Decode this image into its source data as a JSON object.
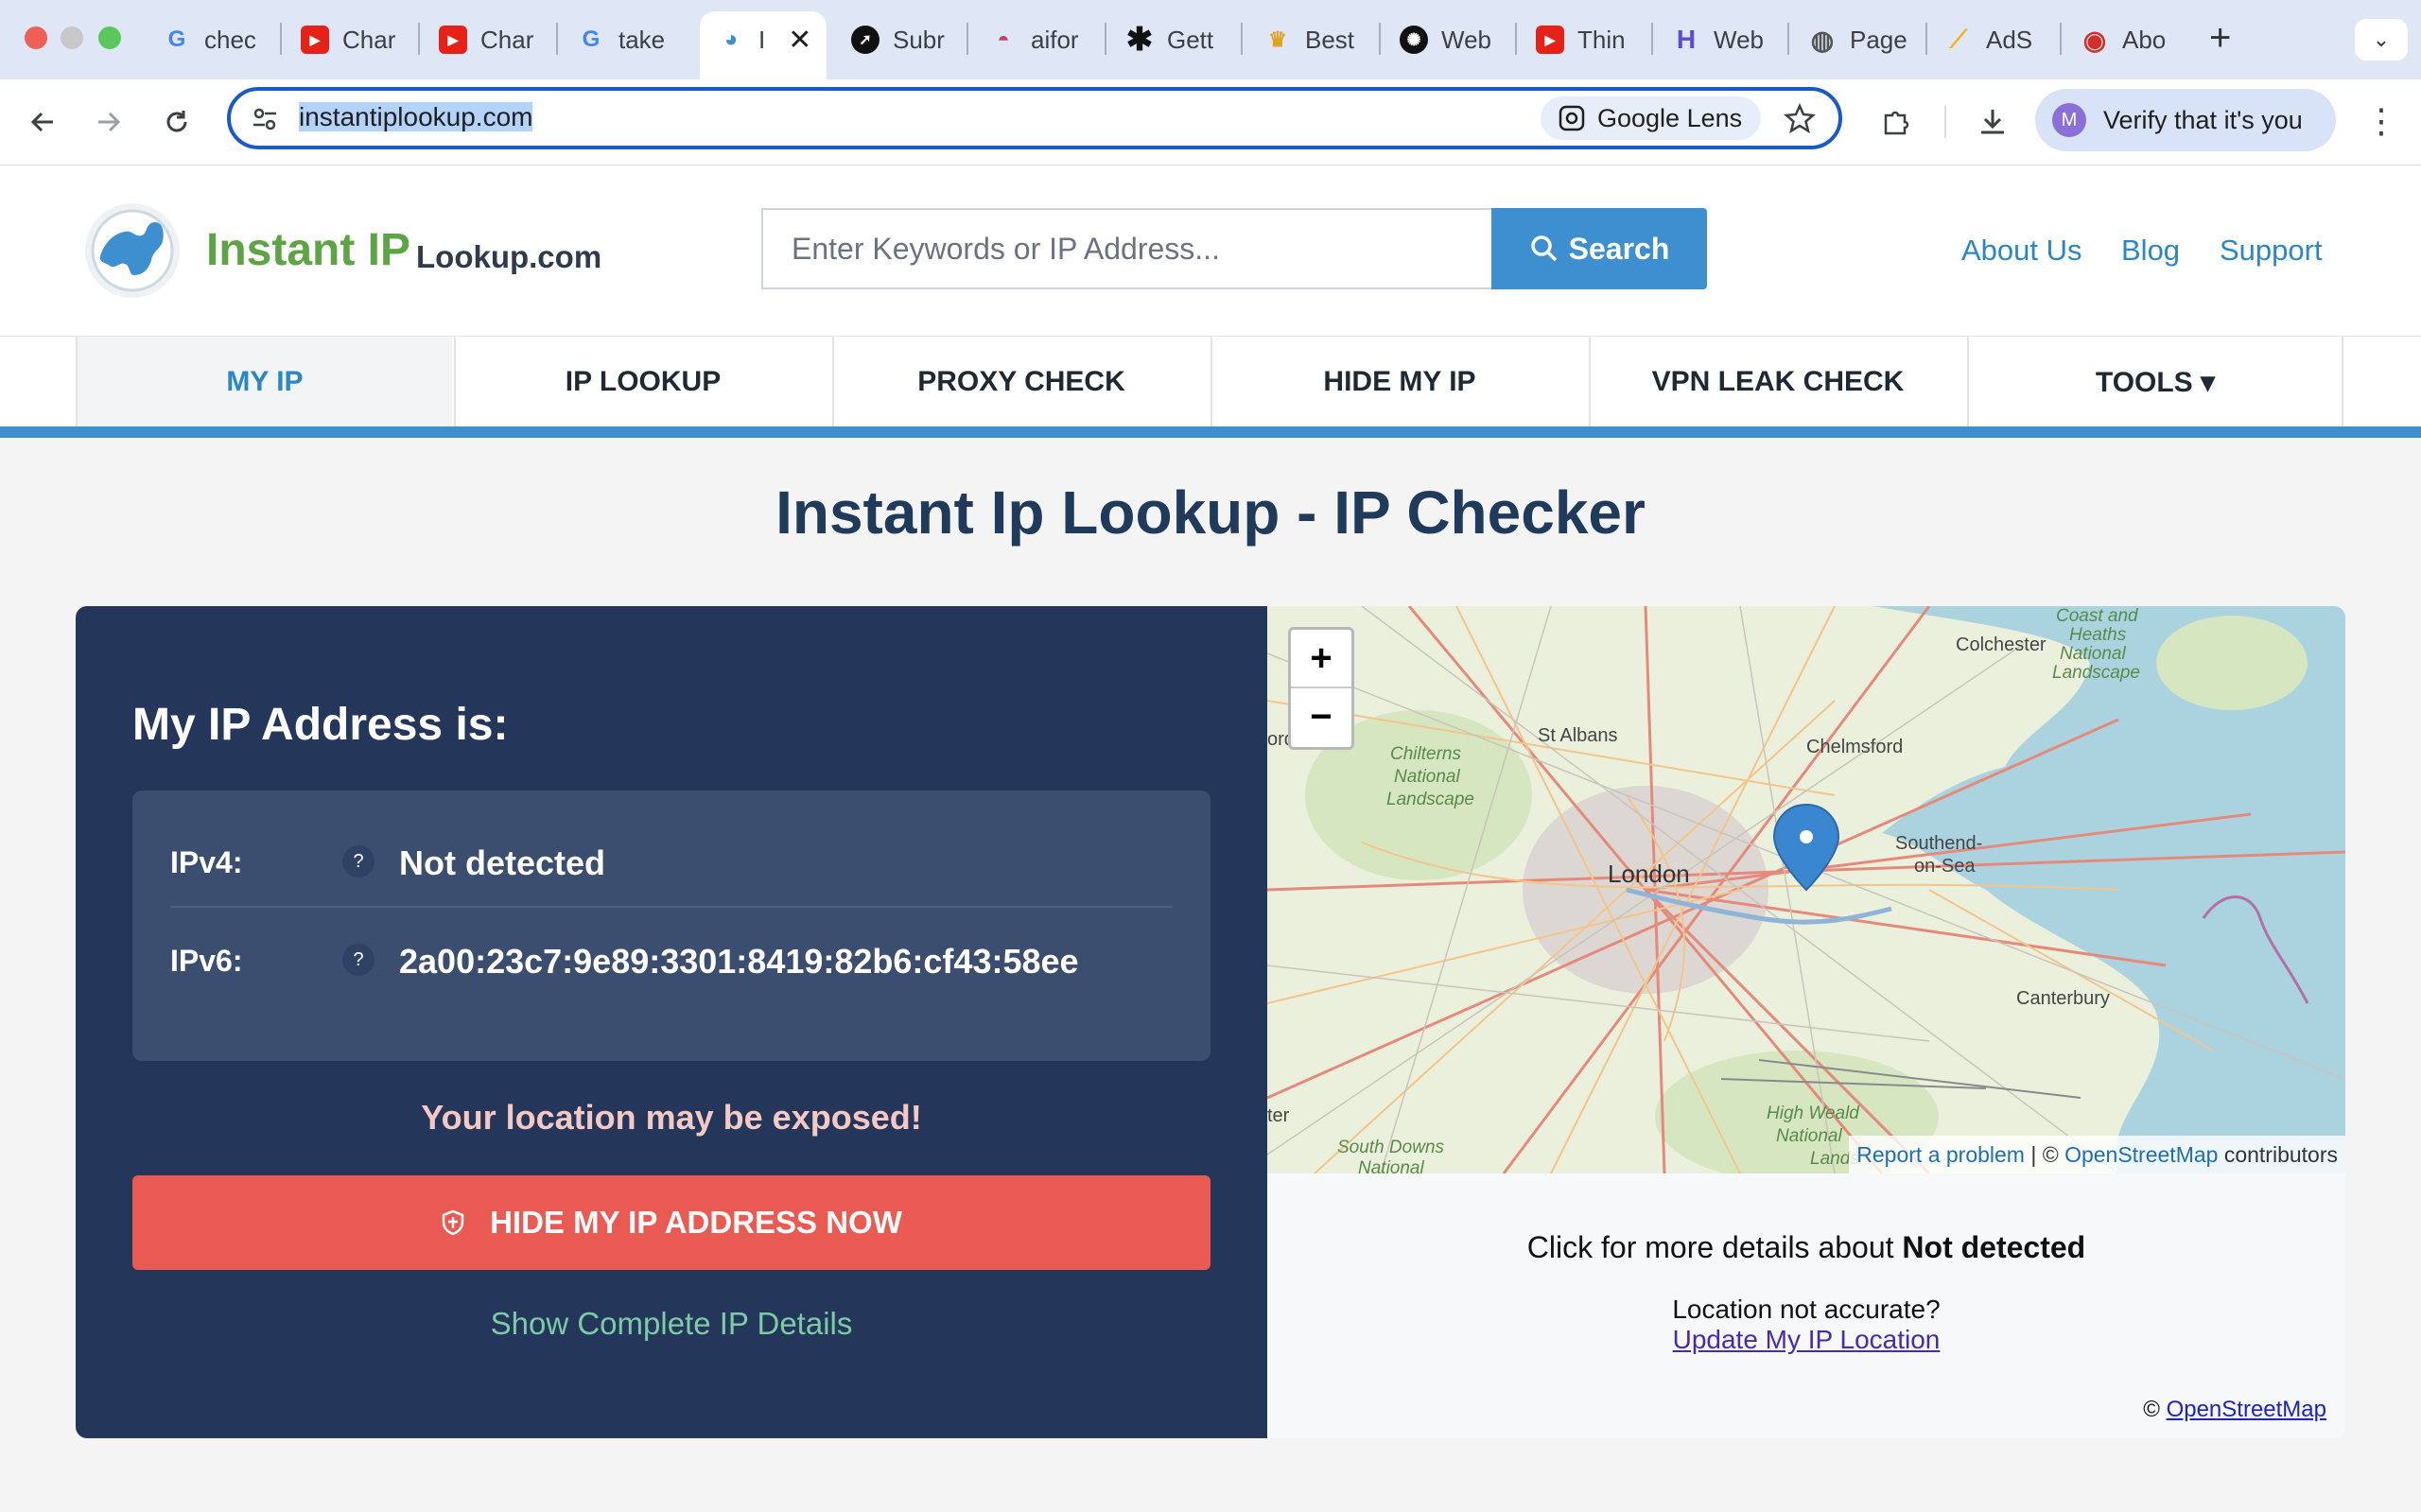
{
  "browser": {
    "tabs": [
      {
        "title": "chec",
        "icon": "google-icon"
      },
      {
        "title": "Char",
        "icon": "youtube-icon"
      },
      {
        "title": "Char",
        "icon": "youtube-icon"
      },
      {
        "title": "take",
        "icon": "google-icon"
      },
      {
        "title": "I",
        "icon": "instantip-icon",
        "active": true
      },
      {
        "title": "Subr",
        "icon": "rocket-icon"
      },
      {
        "title": "aifor",
        "icon": "mascot-icon"
      },
      {
        "title": "Gett",
        "icon": "asterisk-icon"
      },
      {
        "title": "Best",
        "icon": "crown-icon"
      },
      {
        "title": "Web",
        "icon": "openai-icon"
      },
      {
        "title": "Thin",
        "icon": "youtube-icon"
      },
      {
        "title": "Web",
        "icon": "h-logo-icon"
      },
      {
        "title": "Page",
        "icon": "globe-icon"
      },
      {
        "title": "AdS",
        "icon": "adsense-icon"
      },
      {
        "title": "Abo",
        "icon": "target-icon"
      }
    ],
    "url": "instantiplookup.com",
    "lens_label": "Google Lens",
    "profile_initial": "M",
    "profile_label": "Verify that it's you"
  },
  "header": {
    "logo_main": "Instant IP",
    "logo_sub": "Lookup.com",
    "search_placeholder": "Enter Keywords or IP Address...",
    "search_button": "Search",
    "links": [
      "About Us",
      "Blog",
      "Support"
    ]
  },
  "nav": {
    "items": [
      "MY IP",
      "IP LOOKUP",
      "PROXY CHECK",
      "HIDE MY IP",
      "VPN LEAK CHECK",
      "TOOLS ▾"
    ],
    "active": "MY IP"
  },
  "main": {
    "title": "Instant Ip Lookup - IP Checker",
    "card_title": "My IP Address is:",
    "ipv4_label": "IPv4:",
    "ipv4_value": "Not detected",
    "ipv6_label": "IPv6:",
    "ipv6_value": "2a00:23c7:9e89:3301:8419:82b6:cf43:58ee",
    "help_glyph": "?",
    "warning": "Your location may be exposed!",
    "hide_button": "HIDE MY IP ADDRESS NOW",
    "show_details": "Show Complete IP Details"
  },
  "map": {
    "zoom_in": "+",
    "zoom_out": "−",
    "places": [
      "Colchester",
      "St Albans",
      "Chelmsford",
      "London",
      "Southend-",
      "on-Sea",
      "Canterbury",
      "ord",
      "ter"
    ],
    "area_labels": [
      "Coast and",
      "Heaths",
      "National",
      "Landscape",
      "Chilterns",
      "National",
      "Landscape",
      "High Weald",
      "National",
      "Lands",
      "South Downs",
      "National"
    ],
    "attribution_report": "Report a problem",
    "attribution_sep": " | © ",
    "attribution_osm": "OpenStreetMap",
    "attribution_tail": " contributors",
    "details_prefix": "Click for more details about ",
    "details_value": "Not detected",
    "loc_question": "Location not accurate?",
    "loc_update": "Update My IP Location",
    "footer_copy": "© ",
    "footer_osm": "OpenStreetMap"
  },
  "colors": {
    "accent": "#3d8fd0",
    "card_bg": "#24375a",
    "danger": "#e95a52",
    "logo_green": "#5da544"
  }
}
